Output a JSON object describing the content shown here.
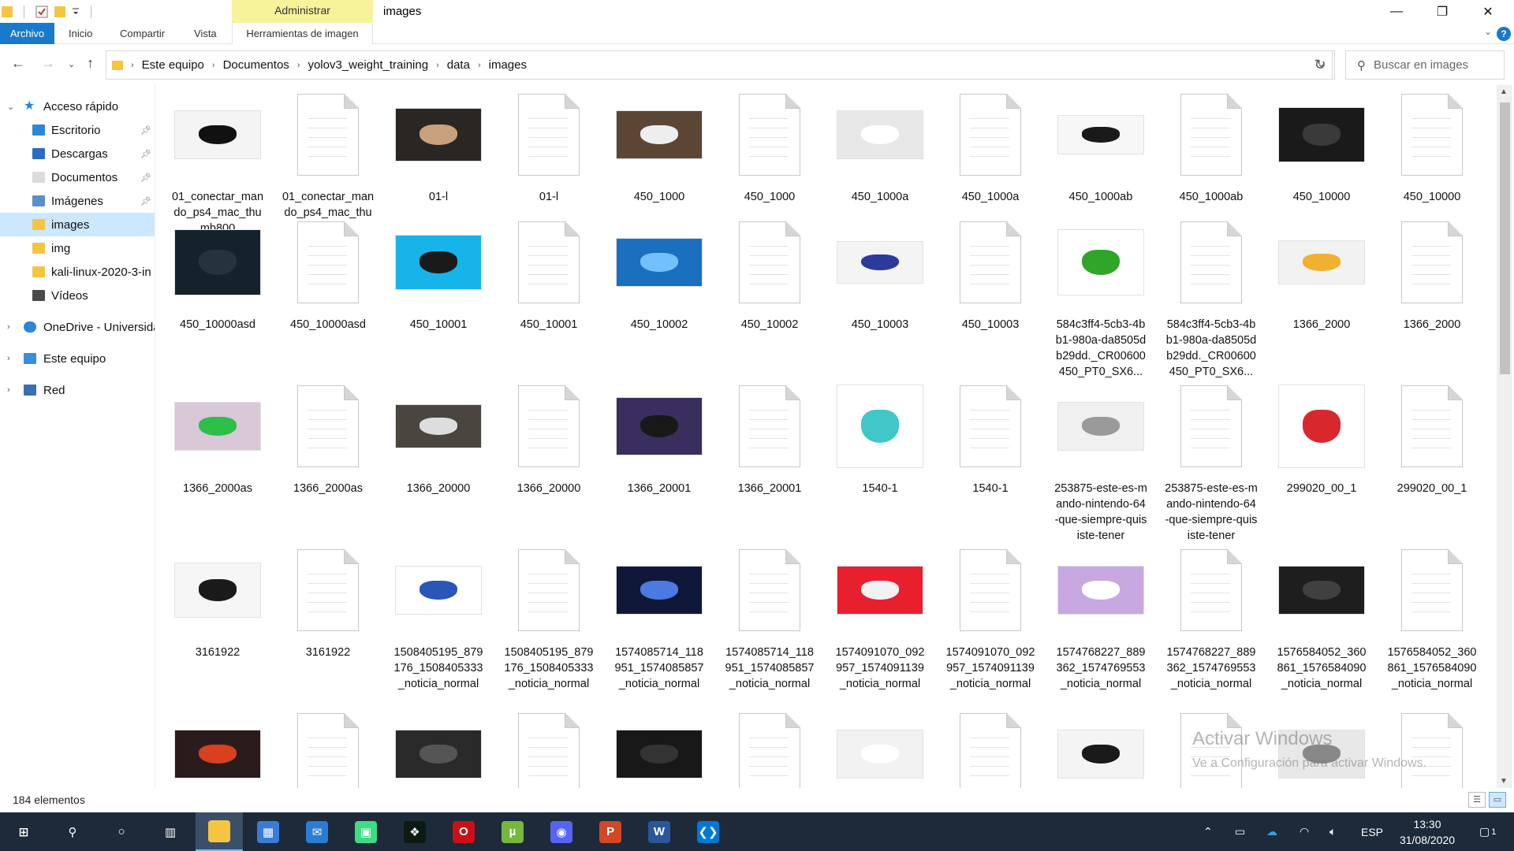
{
  "window": {
    "title": "images",
    "context_tab": "Administrar",
    "minimize": "—",
    "maximize": "❐",
    "close": "✕"
  },
  "ribbon": {
    "tabs": [
      "Archivo",
      "Inicio",
      "Compartir",
      "Vista",
      "Herramientas de imagen"
    ],
    "help": "?"
  },
  "address": {
    "crumbs": [
      "Este equipo",
      "Documentos",
      "yolov3_weight_training",
      "data",
      "images"
    ],
    "search_placeholder": "Buscar en images"
  },
  "nav": {
    "items": [
      {
        "label": "Acceso rápido",
        "icon": "star-icon",
        "level": 0,
        "expanded": true,
        "pinned": false
      },
      {
        "label": "Escritorio",
        "icon": "desktop-icon",
        "level": 1,
        "pinned": true
      },
      {
        "label": "Descargas",
        "icon": "download-icon",
        "level": 1,
        "pinned": true
      },
      {
        "label": "Documentos",
        "icon": "document-icon",
        "level": 1,
        "pinned": true
      },
      {
        "label": "Imágenes",
        "icon": "pictures-icon",
        "level": 1,
        "pinned": true
      },
      {
        "label": "images",
        "icon": "folder-icon",
        "level": 1,
        "pinned": false,
        "selected": true
      },
      {
        "label": "img",
        "icon": "folder-icon",
        "level": 1,
        "pinned": false
      },
      {
        "label": "kali-linux-2020-3-in",
        "icon": "folder-icon",
        "level": 1,
        "pinned": false
      },
      {
        "label": "Vídeos",
        "icon": "videos-icon",
        "level": 1,
        "pinned": false
      },
      {
        "label": "OneDrive - Universida",
        "icon": "cloud-icon",
        "level": 0,
        "expanded": false
      },
      {
        "label": "Este equipo",
        "icon": "computer-icon",
        "level": 0,
        "expanded": false
      },
      {
        "label": "Red",
        "icon": "network-icon",
        "level": 0,
        "expanded": false
      }
    ]
  },
  "files": {
    "rows": [
      [
        {
          "name": "01_conectar_mando_ps4_mac_thumb800",
          "type": "image",
          "color": "#f4f4f4",
          "accent": "#111111",
          "h": 62
        },
        {
          "name": "01_conectar_mando_ps4_mac_thumb800",
          "type": "doc"
        },
        {
          "name": "01-l",
          "type": "image",
          "color": "#2a2623",
          "accent": "#c9a07d",
          "h": 68
        },
        {
          "name": "01-l",
          "type": "doc"
        },
        {
          "name": "450_1000",
          "type": "image",
          "color": "#5b4636",
          "accent": "#eeeeee",
          "h": 62
        },
        {
          "name": "450_1000",
          "type": "doc"
        },
        {
          "name": "450_1000a",
          "type": "image",
          "color": "#e8e8e8",
          "accent": "#ffffff",
          "h": 62
        },
        {
          "name": "450_1000a",
          "type": "doc"
        },
        {
          "name": "450_1000ab",
          "type": "image",
          "color": "#f7f7f7",
          "accent": "#1a1a1a",
          "h": 50
        },
        {
          "name": "450_1000ab",
          "type": "doc"
        },
        {
          "name": "450_10000",
          "type": "image",
          "color": "#1a1a1a",
          "accent": "#3a3a3a",
          "h": 70
        },
        {
          "name": "450_10000",
          "type": "doc"
        }
      ],
      [
        {
          "name": "450_10000asd",
          "type": "image",
          "color": "#14222c",
          "accent": "#24333d",
          "h": 84
        },
        {
          "name": "450_10000asd",
          "type": "doc"
        },
        {
          "name": "450_10001",
          "type": "image",
          "color": "#16b4e8",
          "accent": "#1a1a1a",
          "h": 70
        },
        {
          "name": "450_10001",
          "type": "doc"
        },
        {
          "name": "450_10002",
          "type": "image",
          "color": "#1b6fbf",
          "accent": "#74c0ff",
          "h": 62
        },
        {
          "name": "450_10002",
          "type": "doc"
        },
        {
          "name": "450_10003",
          "type": "image",
          "color": "#f4f4f4",
          "accent": "#2c3a9c",
          "h": 54
        },
        {
          "name": "450_10003",
          "type": "doc"
        },
        {
          "name": "584c3ff4-5cb3-4bb1-980a-da8505db29dd._CR00600450_PT0_SX6...",
          "type": "image",
          "color": "#ffffff",
          "accent": "#2fa52a",
          "h": 84
        },
        {
          "name": "584c3ff4-5cb3-4bb1-980a-da8505db29dd._CR00600450_PT0_SX6...",
          "type": "doc"
        },
        {
          "name": "1366_2000",
          "type": "image",
          "color": "#f2f2f2",
          "accent": "#f0b030",
          "h": 56
        },
        {
          "name": "1366_2000",
          "type": "doc"
        }
      ],
      [
        {
          "name": "1366_2000as",
          "type": "image",
          "color": "#d8c8d8",
          "accent": "#2dbf4a",
          "h": 62
        },
        {
          "name": "1366_2000as",
          "type": "doc"
        },
        {
          "name": "1366_20000",
          "type": "image",
          "color": "#4b4540",
          "accent": "#dddddd",
          "h": 56
        },
        {
          "name": "1366_20000",
          "type": "doc"
        },
        {
          "name": "1366_20001",
          "type": "image",
          "color": "#3a2e5e",
          "accent": "#181818",
          "h": 74
        },
        {
          "name": "1366_20001",
          "type": "doc"
        },
        {
          "name": "1540-1",
          "type": "image",
          "color": "#ffffff",
          "accent": "#40c8c8",
          "h": 106
        },
        {
          "name": "1540-1",
          "type": "doc"
        },
        {
          "name": "253875-este-es-mando-nintendo-64-que-siempre-quisiste-tener",
          "type": "image",
          "color": "#f0f0f0",
          "accent": "#9a9a9a",
          "h": 62
        },
        {
          "name": "253875-este-es-mando-nintendo-64-que-siempre-quisiste-tener",
          "type": "doc"
        },
        {
          "name": "299020_00_1",
          "type": "image",
          "color": "#ffffff",
          "accent": "#d8282c",
          "h": 106
        },
        {
          "name": "299020_00_1",
          "type": "doc"
        }
      ],
      [
        {
          "name": "3161922",
          "type": "image",
          "color": "#f6f6f6",
          "accent": "#1a1a1a",
          "h": 70
        },
        {
          "name": "3161922",
          "type": "doc"
        },
        {
          "name": "1508405195_879176_1508405333_noticia_normal",
          "type": "image",
          "color": "#ffffff",
          "accent": "#2a56b8",
          "h": 62
        },
        {
          "name": "1508405195_879176_1508405333_noticia_normal",
          "type": "doc"
        },
        {
          "name": "1574085714_118951_1574085857_noticia_normal",
          "type": "image",
          "color": "#10183a",
          "accent": "#4c7ae0",
          "h": 62
        },
        {
          "name": "1574085714_118951_1574085857_noticia_normal",
          "type": "doc"
        },
        {
          "name": "1574091070_092957_1574091139_noticia_normal",
          "type": "image",
          "color": "#e8202e",
          "accent": "#f2f2f2",
          "h": 62
        },
        {
          "name": "1574091070_092957_1574091139_noticia_normal",
          "type": "doc"
        },
        {
          "name": "1574768227_889362_1574769553_noticia_normal",
          "type": "image",
          "color": "#c8a8e0",
          "accent": "#ffffff",
          "h": 62
        },
        {
          "name": "1574768227_889362_1574769553_noticia_normal",
          "type": "doc"
        },
        {
          "name": "1576584052_360861_1576584090_noticia_normal",
          "type": "image",
          "color": "#1e1e1e",
          "accent": "#404040",
          "h": 62
        },
        {
          "name": "1576584052_360861_1576584090_noticia_normal",
          "type": "doc"
        }
      ],
      [
        {
          "name": "",
          "type": "image",
          "color": "#2a1c1c",
          "accent": "#d84020",
          "h": 62
        },
        {
          "name": "",
          "type": "doc"
        },
        {
          "name": "",
          "type": "image",
          "color": "#2a2a2a",
          "accent": "#555555",
          "h": 62
        },
        {
          "name": "",
          "type": "doc"
        },
        {
          "name": "",
          "type": "image",
          "color": "#181818",
          "accent": "#333333",
          "h": 62
        },
        {
          "name": "",
          "type": "doc"
        },
        {
          "name": "",
          "type": "image",
          "color": "#f2f2f2",
          "accent": "#ffffff",
          "h": 62
        },
        {
          "name": "",
          "type": "doc"
        },
        {
          "name": "",
          "type": "image",
          "color": "#f4f4f4",
          "accent": "#1a1a1a",
          "h": 62
        },
        {
          "name": "",
          "type": "doc"
        },
        {
          "name": "",
          "type": "image",
          "color": "#e8e8e8",
          "accent": "#888888",
          "h": 62
        },
        {
          "name": "",
          "type": "doc"
        }
      ]
    ]
  },
  "watermark": {
    "line1": "Activar Windows",
    "line2": "Ve a Configuración para activar Windows."
  },
  "status": {
    "count": "184 elementos"
  },
  "taskbar": {
    "apps": [
      {
        "name": "start-button",
        "icon": "windows-logo-icon",
        "color": "#1c2a3a",
        "glyph": "⊞"
      },
      {
        "name": "search-button",
        "icon": "search-icon",
        "color": "#1c2a3a",
        "glyph": "⚲"
      },
      {
        "name": "cortana-button",
        "icon": "cortana-icon",
        "color": "#1c2a3a",
        "glyph": "○"
      },
      {
        "name": "task-view-button",
        "icon": "task-view-icon",
        "color": "#1c2a3a",
        "glyph": "▥"
      },
      {
        "name": "file-explorer-app",
        "icon": "file-explorer-icon",
        "color": "#f5c542",
        "glyph": "",
        "active": true
      },
      {
        "name": "store-app",
        "icon": "store-icon",
        "color": "#3a7bd5",
        "glyph": "▦"
      },
      {
        "name": "mail-app",
        "icon": "mail-icon",
        "color": "#2b7cd3",
        "glyph": "✉"
      },
      {
        "name": "android-app",
        "icon": "android-icon",
        "color": "#3ddc84",
        "glyph": "▣"
      },
      {
        "name": "terminal-app",
        "icon": "terminal-icon",
        "color": "#0d1a12",
        "glyph": "❖"
      },
      {
        "name": "opera-app",
        "icon": "opera-icon",
        "color": "#cc0f16",
        "glyph": "O"
      },
      {
        "name": "utorrent-app",
        "icon": "utorrent-icon",
        "color": "#76b83f",
        "glyph": "µ"
      },
      {
        "name": "discord-app",
        "icon": "discord-icon",
        "color": "#5865f2",
        "glyph": "◉"
      },
      {
        "name": "powerpoint-app",
        "icon": "powerpoint-icon",
        "color": "#d24726",
        "glyph": "P"
      },
      {
        "name": "word-app",
        "icon": "word-icon",
        "color": "#2b579a",
        "glyph": "W"
      },
      {
        "name": "vscode-app",
        "icon": "vscode-icon",
        "color": "#0078d4",
        "glyph": "❮❯"
      }
    ],
    "tray": {
      "language": "ESP",
      "time": "13:30",
      "date": "31/08/2020",
      "notifications": "1"
    }
  }
}
